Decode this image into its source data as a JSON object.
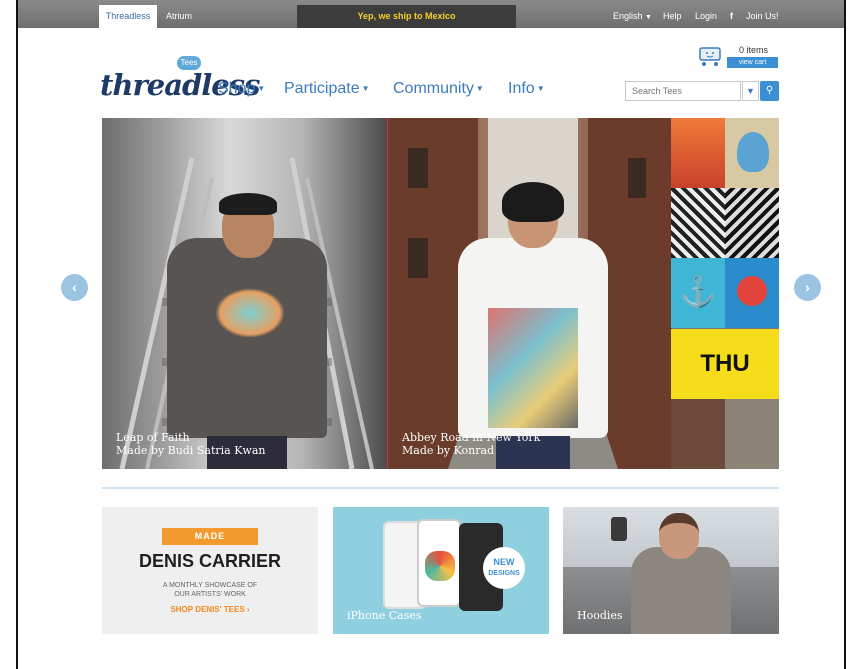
{
  "topbar": {
    "tabs": [
      "Threadless",
      "Atrium"
    ],
    "banner": "Yep, we ship to Mexico",
    "language": "English",
    "help": "Help",
    "login": "Login",
    "fb": "f",
    "join": "Join Us!"
  },
  "header": {
    "logo": "threadless",
    "logo_badge": "Tees",
    "nav": [
      "Shop",
      "Participate",
      "Community",
      "Info"
    ],
    "cart": {
      "items": "0 items",
      "view_cart": "view cart"
    },
    "search": {
      "placeholder": "Search Tees"
    }
  },
  "hero": {
    "slides": [
      {
        "title": "Leap of Faith",
        "credit": "Made by Budi Satria Kwan"
      },
      {
        "title": "Abbey Road in New York",
        "credit": "Made by Konrad"
      }
    ],
    "thu_tile": "THU",
    "prev_arrow": "‹",
    "next_arrow": "›"
  },
  "cards": {
    "made_banner": "MADE",
    "artist": "DENIS CARRIER",
    "showcase": [
      "A MONTHLY SHOWCASE OF",
      "OUR ARTISTS' WORK"
    ],
    "shop_link": "SHOP DENIS' TEES ›",
    "iphone_label": "iPhone Cases",
    "new_badge": [
      "NEW",
      "DESIGNS"
    ],
    "hoodies_label": "Hoodies"
  },
  "colors": {
    "accent_blue": "#3d8fd4",
    "nav_blue": "#3d7bbd",
    "banner_yellow": "#f2d12e",
    "made_orange": "#f39a2e"
  }
}
